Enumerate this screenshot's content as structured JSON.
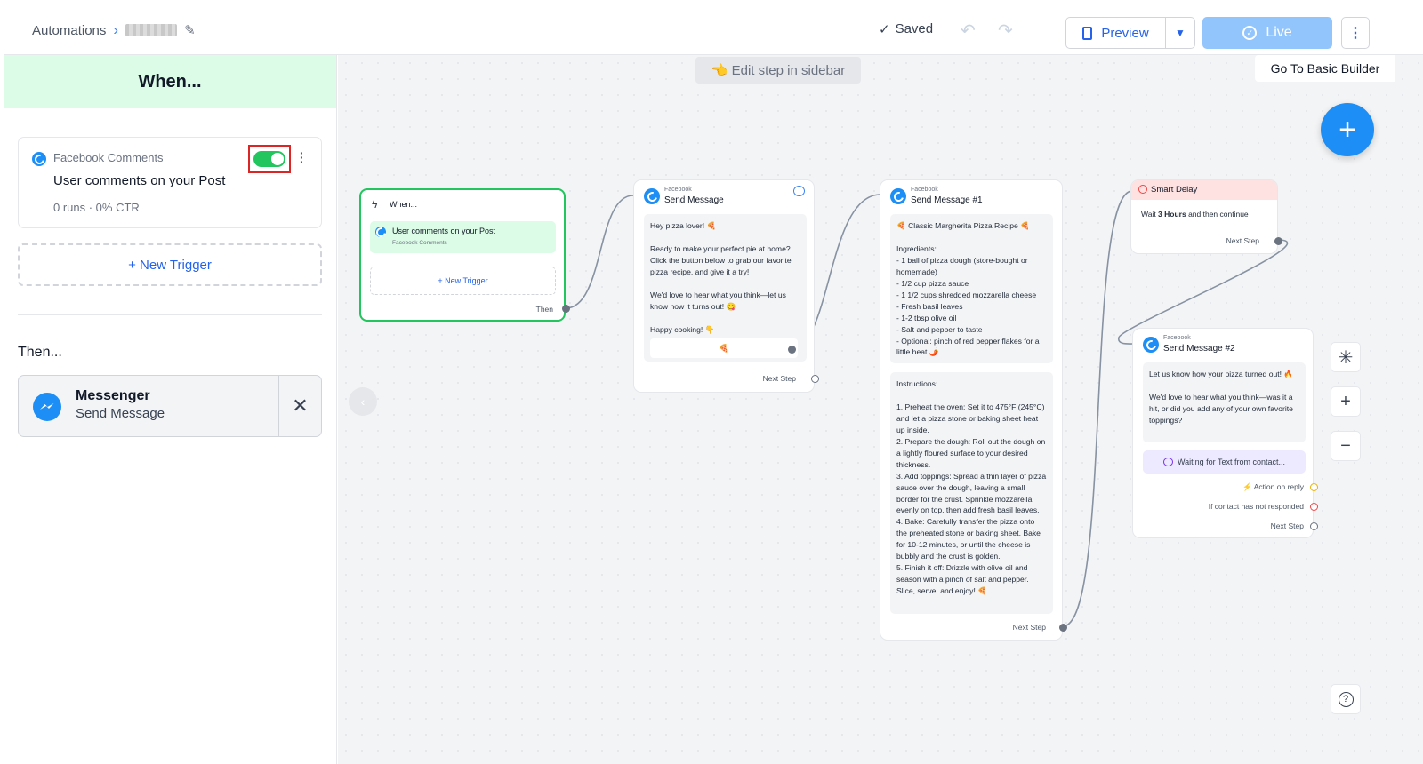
{
  "header": {
    "breadcrumb_root": "Automations",
    "breadcrumb_sep": "›",
    "saved_label": "Saved",
    "saved_check": "✓",
    "preview_label": "Preview",
    "live_label": "Live"
  },
  "sidebar": {
    "heading": "When...",
    "trigger": {
      "source": "Facebook Comments",
      "title": "User comments on your Post",
      "stats": "0 runs · 0% CTR",
      "enabled": true
    },
    "new_trigger": "+ New Trigger",
    "then_label": "Then...",
    "action": {
      "title": "Messenger",
      "subtitle": "Send Message"
    }
  },
  "canvas": {
    "edit_hint": "👈 Edit step in sidebar",
    "basic_builder": "Go To Basic Builder",
    "when_node": {
      "title": "When...",
      "trigger_title": "User comments on your Post",
      "trigger_source": "Facebook Comments",
      "new_trigger": "+ New Trigger",
      "then": "Then"
    },
    "send1": {
      "channel": "Facebook",
      "title": "Send Message",
      "text": "Hey pizza lover! 🍕\n\nReady to make your perfect pie at home? Click the button below to grab our favorite pizza recipe, and give it a try!\n\nWe'd love to hear what you think—let us know how it turns out! 😋\n\nHappy cooking! 👇",
      "button_emoji": "🍕",
      "next": "Next Step"
    },
    "send2": {
      "channel": "Facebook",
      "title": "Send Message #1",
      "recipe": "🍕 Classic Margherita Pizza Recipe 🍕\n\nIngredients:\n- 1 ball of pizza dough (store-bought or homemade)\n- 1/2 cup pizza sauce\n- 1 1/2 cups shredded mozzarella cheese\n- Fresh basil leaves\n- 1-2 tbsp olive oil\n- Salt and pepper to taste\n- Optional: pinch of red pepper flakes for a little heat 🌶️",
      "instructions": "Instructions:\n\n1. Preheat the oven: Set it to 475°F (245°C) and let a pizza stone or baking sheet heat up inside.\n2. Prepare the dough: Roll out the dough on a lightly floured surface to your desired thickness.\n3. Add toppings: Spread a thin layer of pizza sauce over the dough, leaving a small border for the crust. Sprinkle mozzarella evenly on top, then add fresh basil leaves.\n4. Bake: Carefully transfer the pizza onto the preheated stone or baking sheet. Bake for 10-12 minutes, or until the cheese is bubbly and the crust is golden.\n5. Finish it off: Drizzle with olive oil and season with a pinch of salt and pepper. Slice, serve, and enjoy! 🍕",
      "next": "Next Step"
    },
    "delay": {
      "title": "Smart Delay",
      "text_pre": "Wait ",
      "amount": "3 Hours",
      "text_post": " and then continue",
      "next": "Next Step"
    },
    "send3": {
      "channel": "Facebook",
      "title": "Send Message #2",
      "text1": "Let us know how your pizza turned out! 🔥",
      "text2": "We'd love to hear what you think—was it a hit, or did you add any of your own favorite toppings?",
      "waiting": "Waiting for Text from contact...",
      "action_reply": "Action on reply",
      "not_responded": "If contact has not responded",
      "next": "Next Step"
    }
  },
  "colors": {
    "accent": "#1d8ef5",
    "live_disabled": "#93c5fd",
    "trigger_green": "#22c55e",
    "delay_header": "#fee2e2",
    "highlight_red": "#dc2626"
  }
}
